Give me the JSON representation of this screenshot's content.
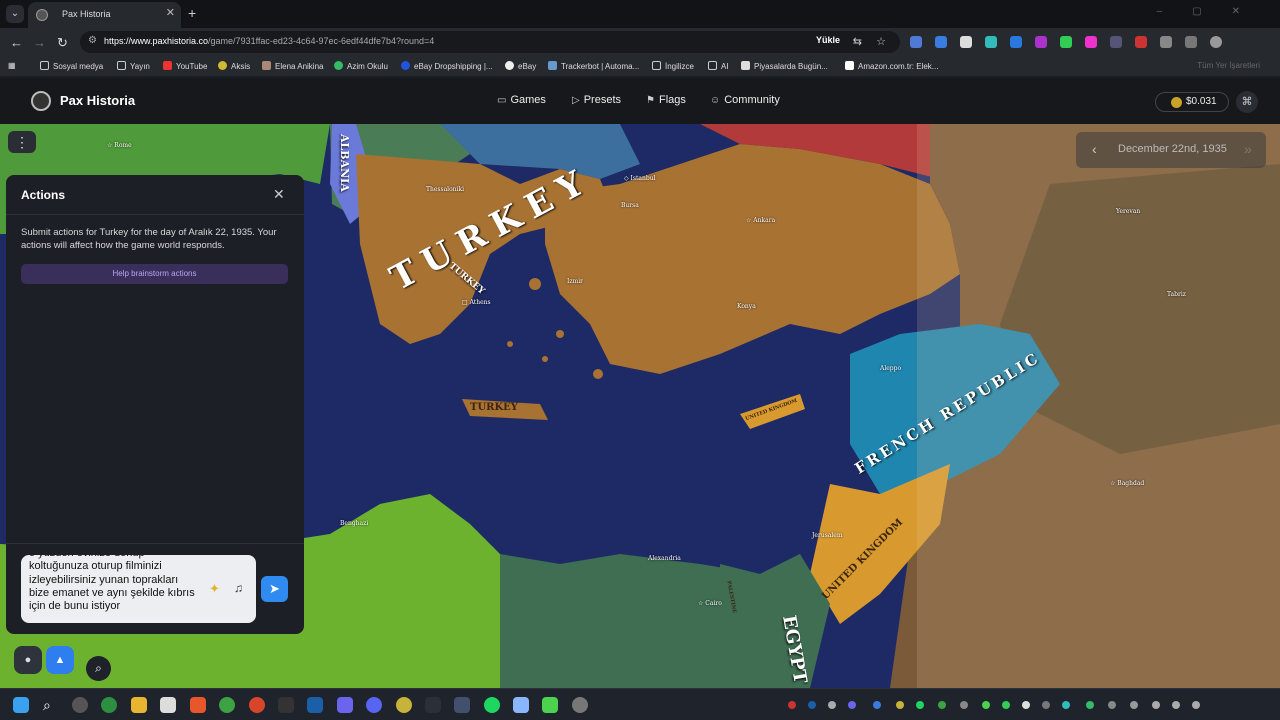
{
  "browser": {
    "tab_title": "Pax Historia",
    "url_host": "https://www.paxhistoria.co",
    "url_path": "/game/7931ffac-ed23-4c64-97ec-6edf44dfe7b4?round=4",
    "install_label": "Yükle",
    "bookmarks": [
      "Sosyal medya",
      "Yayın",
      "YouTube",
      "Aksis",
      "Elena Anikina",
      "Azim Okulu",
      "eBay Dropshipping |...",
      "eBay",
      "Trackerbot | Automa...",
      "İngilizce",
      "AI",
      "Piyasalarda Bugün...",
      "Amazon.com.tr: Elek..."
    ],
    "all_bookmarks": "Tüm Yer İşaretleri"
  },
  "site": {
    "brand": "Pax Historia",
    "nav": [
      "Games",
      "Presets",
      "Flags",
      "Community"
    ],
    "balance": "$0.031"
  },
  "map": {
    "date": "December 22nd, 1935",
    "countries": [
      "ALBANIA",
      "TURKEY",
      "TURKEY",
      "TURKEY",
      "UNITED KINGDOM",
      "FRENCH REPUBLIC",
      "UNITED KINGDOM",
      "EGYPT",
      "PALESTINE"
    ],
    "cities": [
      "Rome",
      "Thessaloniki",
      "Istanbul",
      "Bursa",
      "Ankara",
      "Izmir",
      "Athens",
      "Konya",
      "Aleppo",
      "Yerevan",
      "Tabriz",
      "Baghdad",
      "Benghazi",
      "Alexandria",
      "Cairo",
      "Jerusalem"
    ]
  },
  "actions": {
    "title": "Actions",
    "description": "Submit actions for Turkey for the day of Aralık 22, 1935. Your actions will affect how the game world responds.",
    "brainstorm": "Help brainstorm actions",
    "input_text": "o yüzden evinize dönüp koltuğunuza oturup filminizi izleyebilirsiniz yunan toprakları bize emanet ve aynı şekilde kıbrıs için de bunu istiyor"
  },
  "colors": {
    "sea": "#1e2a66",
    "turkey": "#a87233",
    "france": "#1f86b0",
    "uk": "#d89a2e",
    "accent": "#2f8bf0"
  }
}
